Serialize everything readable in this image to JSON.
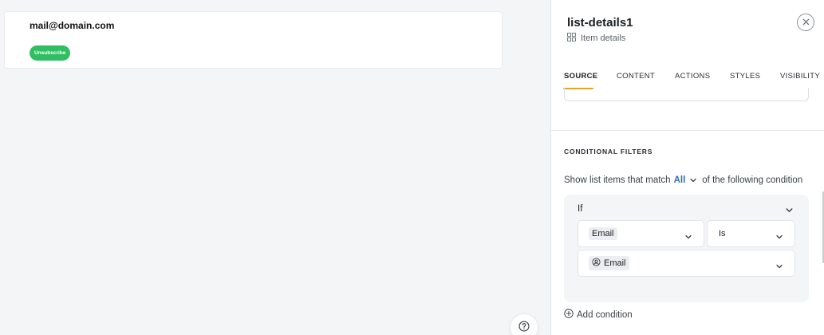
{
  "canvas": {
    "card": {
      "email": "mail@domain.com",
      "unsubscribe_label": "Unsubscribe"
    },
    "help_icon": "question-circle-icon"
  },
  "panel": {
    "title": "list-details1",
    "subtitle": "Item details",
    "subtitle_icon": "grid-icon",
    "close_icon": "close-icon",
    "tabs": [
      {
        "label": "SOURCE",
        "active": true
      },
      {
        "label": "CONTENT",
        "active": false
      },
      {
        "label": "ACTIONS",
        "active": false
      },
      {
        "label": "STYLES",
        "active": false
      },
      {
        "label": "VISIBILITY",
        "active": false
      }
    ],
    "conditional_filters": {
      "title": "CONDITIONAL FILTERS",
      "match_prefix": "Show list items that match",
      "match_value": "All",
      "match_suffix": "of the following condition",
      "if_label": "If",
      "field": "Email",
      "operator": "Is",
      "value": "Email",
      "value_icon": "at-sign-icon",
      "add_condition": "Add condition",
      "add_icon": "plus-circle-icon"
    }
  },
  "colors": {
    "accent_tab": "#e4a42a",
    "unsubscribe_bg": "#2fbf62",
    "link_blue": "#2f6fb5"
  }
}
